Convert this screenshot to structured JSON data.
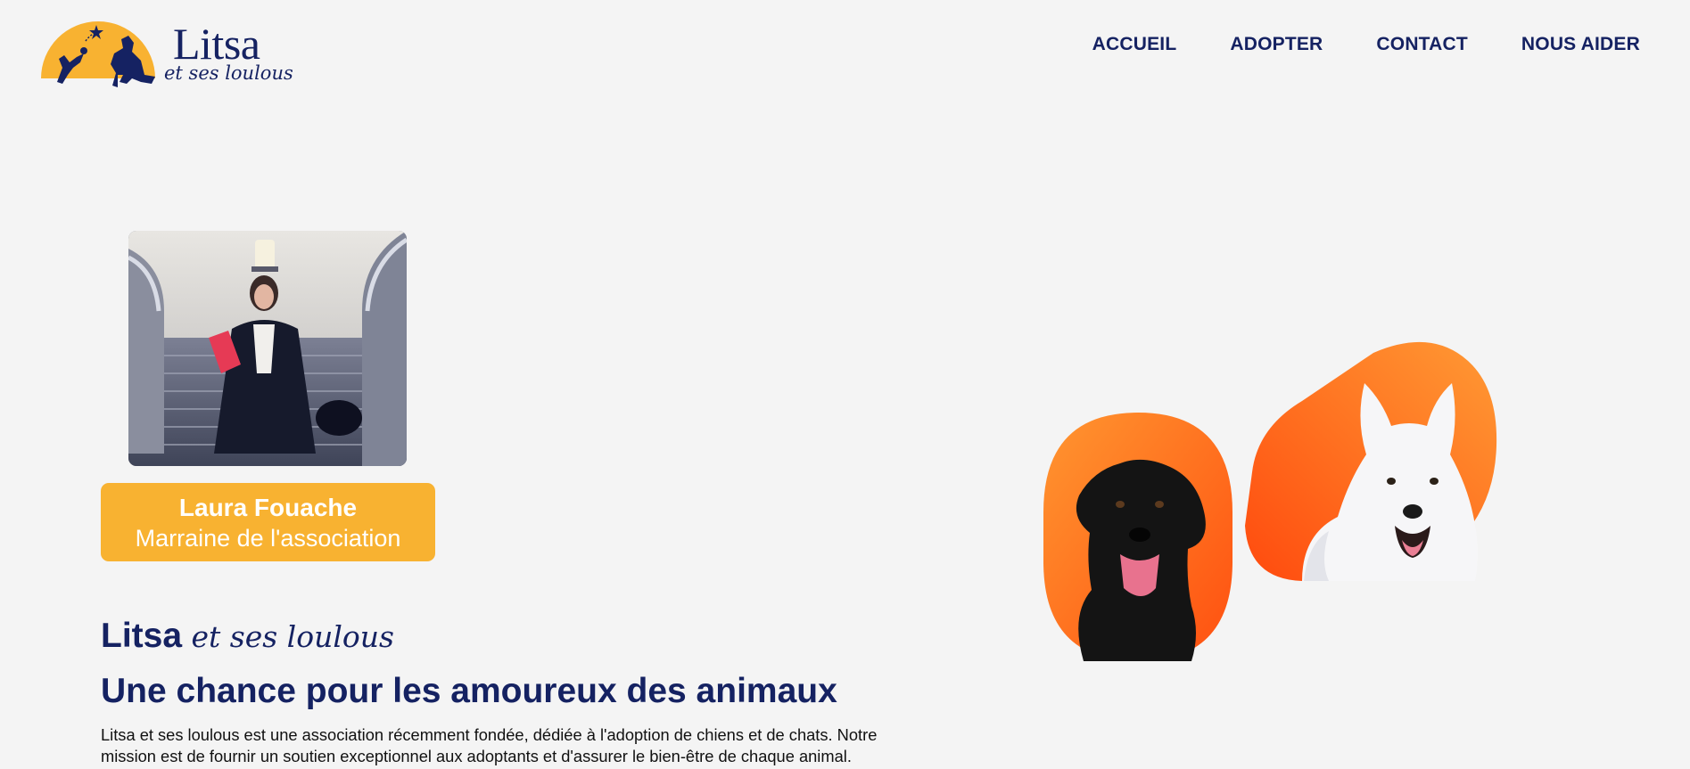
{
  "logo": {
    "title": "Litsa",
    "subtitle": "et ses loulous",
    "sun_color": "#f8b231",
    "silhouette_color": "#152262"
  },
  "nav": {
    "items": [
      {
        "label": "ACCUEIL"
      },
      {
        "label": "ADOPTER"
      },
      {
        "label": "CONTACT"
      },
      {
        "label": "NOUS AIDER"
      }
    ]
  },
  "sponsor": {
    "name": "Laura Fouache",
    "role": "Marraine de l'association",
    "card_color": "#f8b231"
  },
  "intro": {
    "brand_main": "Litsa",
    "brand_script": "et ses loulous",
    "headline": "Une chance pour les amoureux des animaux",
    "body": "Litsa et ses loulous est une association récemment fondée, dédiée à l'adoption de chiens et de chats. Notre mission est de fournir un soutien exceptionnel aux adoptants et d'assurer le bien-être de chaque animal."
  },
  "colors": {
    "navy": "#152262",
    "orange_light": "#ff8a2a",
    "orange_dark": "#ff5a12",
    "background": "#f4f4f4"
  }
}
